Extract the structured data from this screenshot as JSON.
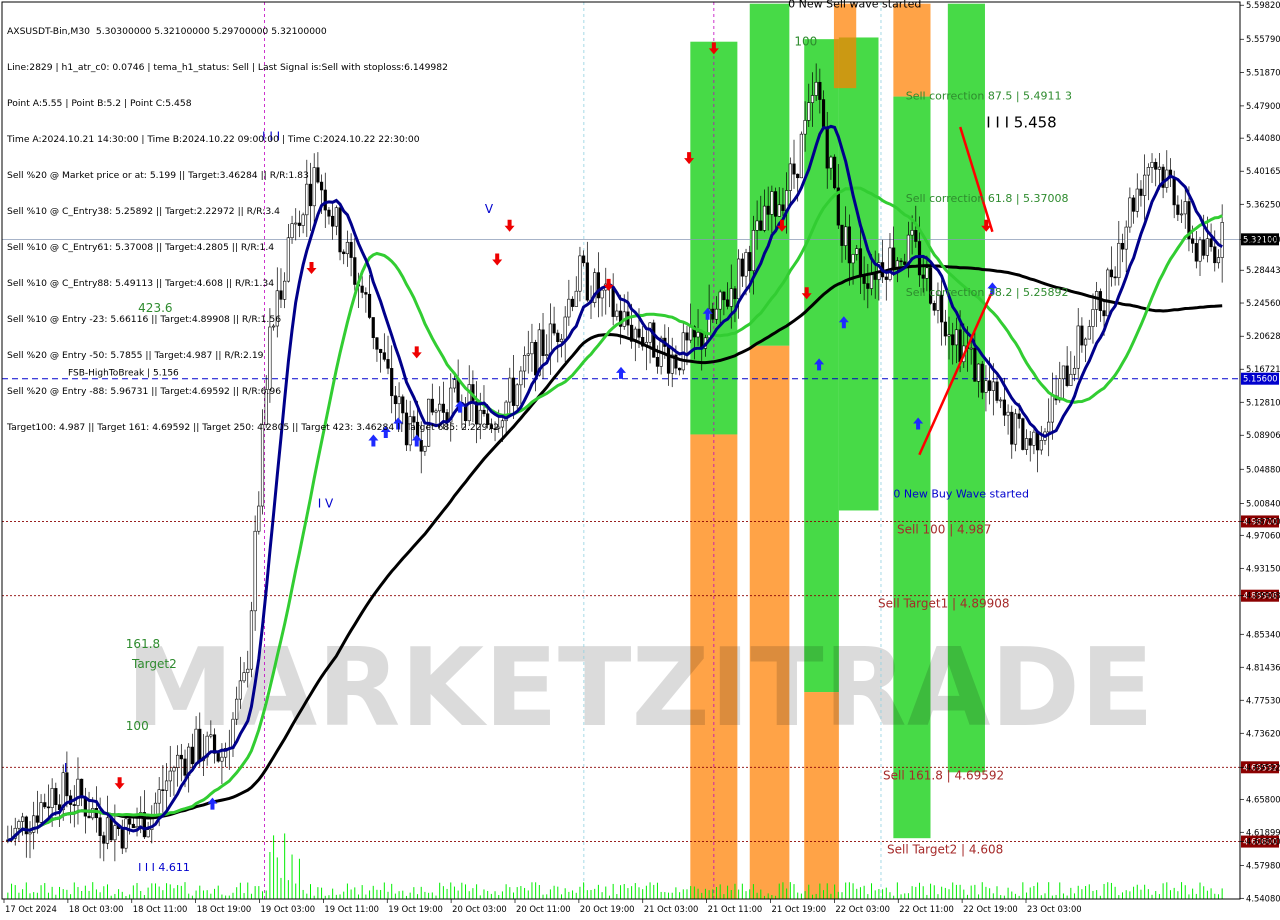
{
  "info_lines": [
    "AXSUSDT-Bin,M30  5.30300000 5.32100000 5.29700000 5.32100000",
    "Line:2829 | h1_atr_c0: 0.0746 | tema_h1_status: Sell | Last Signal is:Sell with stoploss:6.149982",
    "Point A:5.55 | Point B:5.2 | Point C:5.458",
    "Time A:2024.10.21 14:30:00 | Time B:2024.10.22 09:00:00 | Time C:2024.10.22 22:30:00",
    "Sell %20 @ Market price or at: 5.199 || Target:3.46284 || R/R:1.83",
    "Sell %10 @ C_Entry38: 5.25892 || Target:2.22972 || R/R:3.4",
    "Sell %10 @ C_Entry61: 5.37008 || Target:4.2805 || R/R:1.4",
    "Sell %10 @ C_Entry88: 5.49113 || Target:4.608 || R/R:1.34",
    "Sell %10 @ Entry -23: 5.66116 || Target:4.89908 || R/R:1.56",
    "Sell %20 @ Entry -50: 5.7855 || Target:4.987 || R/R:2.19",
    "Sell %20 @ Entry -88: 5.96731 || Target:4.69592 || R/R:6.96",
    "Target100: 4.987 || Target 161: 4.69592 || Target 250: 4.2805 || Target 423: 3.46284 || Target 685: 2.22972"
  ],
  "watermark": "MARKETZITRADE",
  "colors": {
    "ma_fast": "#00008b",
    "ma_mid": "#32cd32",
    "ma_slow": "#000000",
    "bull_zone": "#00cc00",
    "bear_zone": "#ff7f00",
    "target_line": "#8b0000",
    "fsb_line": "#0000cd",
    "label_green": "#2e8b2e",
    "label_red": "#a52a2a",
    "label_blue": "#0000cd",
    "wedge": "#ff0000",
    "volume": "#00ee00"
  },
  "chart_data": {
    "type": "candlestick",
    "symbol": "AXSUSDT-Bin",
    "timeframe": "M30",
    "ylim": [
      4.54,
      5.602
    ],
    "last_price": 5.321,
    "y_ticks": [
      "5.59820",
      "5.55790",
      "5.51870",
      "5.47900",
      "5.44080",
      "5.40165",
      "5.36250",
      "5.32100",
      "5.28443",
      "5.24560",
      "5.20628",
      "5.16721",
      "5.12810",
      "5.08906",
      "5.04880",
      "5.00840",
      "4.98700",
      "4.97060",
      "4.93150",
      "4.89908",
      "4.85340",
      "4.81436",
      "4.77530",
      "4.73620",
      "4.69592",
      "4.65800",
      "4.61899",
      "4.60800",
      "4.57980",
      "4.54080"
    ],
    "x_labels": [
      "17 Oct 2024",
      "18 Oct 03:00",
      "18 Oct 11:00",
      "18 Oct 19:00",
      "19 Oct 03:00",
      "19 Oct 11:00",
      "19 Oct 19:00",
      "20 Oct 03:00",
      "20 Oct 11:00",
      "20 Oct 19:00",
      "21 Oct 03:00",
      "21 Oct 11:00",
      "21 Oct 19:00",
      "22 Oct 03:00",
      "22 Oct 11:00",
      "22 Oct 19:00",
      "23 Oct 03:00"
    ],
    "levels": [
      {
        "name": "FSB-HighToBreak",
        "value": 5.156,
        "label": "FSB-HighToBreak | 5.156",
        "axis_label": "5.15600",
        "style": "dash"
      },
      {
        "name": "Sell 100",
        "value": 4.987,
        "label": "Sell 100 | 4.987",
        "axis_label": "4.98700",
        "style": "dot"
      },
      {
        "name": "Sell Target1",
        "value": 4.89908,
        "label": "Sell Target1 | 4.89908",
        "axis_label": "4.89908",
        "style": "dot"
      },
      {
        "name": "Sell 161.8",
        "value": 4.69592,
        "label": "Sell 161.8 | 4.69592",
        "axis_label": "4.69592",
        "style": "dot"
      },
      {
        "name": "Sell Target2",
        "value": 4.608,
        "label": "Sell Target2 | 4.608",
        "axis_label": "4.60800",
        "style": "dot"
      },
      {
        "name": "Current",
        "value": 5.321,
        "label": "",
        "axis_label": "5.32100",
        "style": "solid"
      }
    ],
    "annotations": [
      {
        "text": "0 New Sell wave started",
        "x": 0.635,
        "y": 5.6,
        "color": "#000000"
      },
      {
        "text": "I I I 5.458",
        "x": 0.795,
        "y": 5.458,
        "color": "#000000"
      },
      {
        "text": "Sell correction 87.5 | 5.4911 3",
        "x": 0.73,
        "y": 5.4911,
        "color": "#2e8b2e"
      },
      {
        "text": "Sell correction 61.8 | 5.37008",
        "x": 0.73,
        "y": 5.37008,
        "color": "#2e8b2e"
      },
      {
        "text": "Sell correction 38.2 | 5.25892",
        "x": 0.73,
        "y": 5.25892,
        "color": "#2e8b2e"
      },
      {
        "text": "0 New Buy Wave started",
        "x": 0.72,
        "y": 5.02,
        "color": "#0000cd"
      },
      {
        "text": "423.6",
        "x": 0.11,
        "y": 5.24,
        "color": "#2e8b2e"
      },
      {
        "text": "161.8",
        "x": 0.1,
        "y": 4.842,
        "color": "#2e8b2e"
      },
      {
        "text": "Target2",
        "x": 0.105,
        "y": 4.818,
        "color": "#2e8b2e"
      },
      {
        "text": "100",
        "x": 0.1,
        "y": 4.745,
        "color": "#2e8b2e"
      },
      {
        "text": "I I I 4.611",
        "x": 0.11,
        "y": 4.578,
        "color": "#0000cd"
      },
      {
        "text": "I I I",
        "x": 0.21,
        "y": 5.443,
        "color": "#0000cd"
      },
      {
        "text": "V",
        "x": 0.39,
        "y": 5.357,
        "color": "#0000cd"
      },
      {
        "text": "I V",
        "x": 0.255,
        "y": 5.008,
        "color": "#0000cd"
      },
      {
        "text": "I",
        "x": 0.05,
        "y": 4.695,
        "color": "#0000cd"
      },
      {
        "text": "100",
        "x": 0.64,
        "y": 5.555,
        "color": "#2e8b2e"
      }
    ],
    "sample_closes": [
      4.61,
      4.64,
      4.67,
      4.66,
      4.63,
      4.62,
      4.64,
      4.7,
      4.72,
      4.71,
      4.8,
      5.2,
      5.35,
      5.4,
      5.32,
      5.25,
      5.15,
      5.08,
      5.12,
      5.14,
      5.1,
      5.13,
      5.18,
      5.21,
      5.28,
      5.25,
      5.22,
      5.2,
      5.18,
      5.2,
      5.24,
      5.3,
      5.35,
      5.4,
      5.5,
      5.33,
      5.28,
      5.3,
      5.31,
      5.25,
      5.2,
      5.15,
      5.1,
      5.08,
      5.13,
      5.2,
      5.25,
      5.35,
      5.42,
      5.38,
      5.3,
      5.32
    ],
    "series": [
      {
        "name": "MA fast",
        "kind": "line"
      },
      {
        "name": "MA mid",
        "kind": "line"
      },
      {
        "name": "MA slow",
        "kind": "line"
      }
    ]
  }
}
